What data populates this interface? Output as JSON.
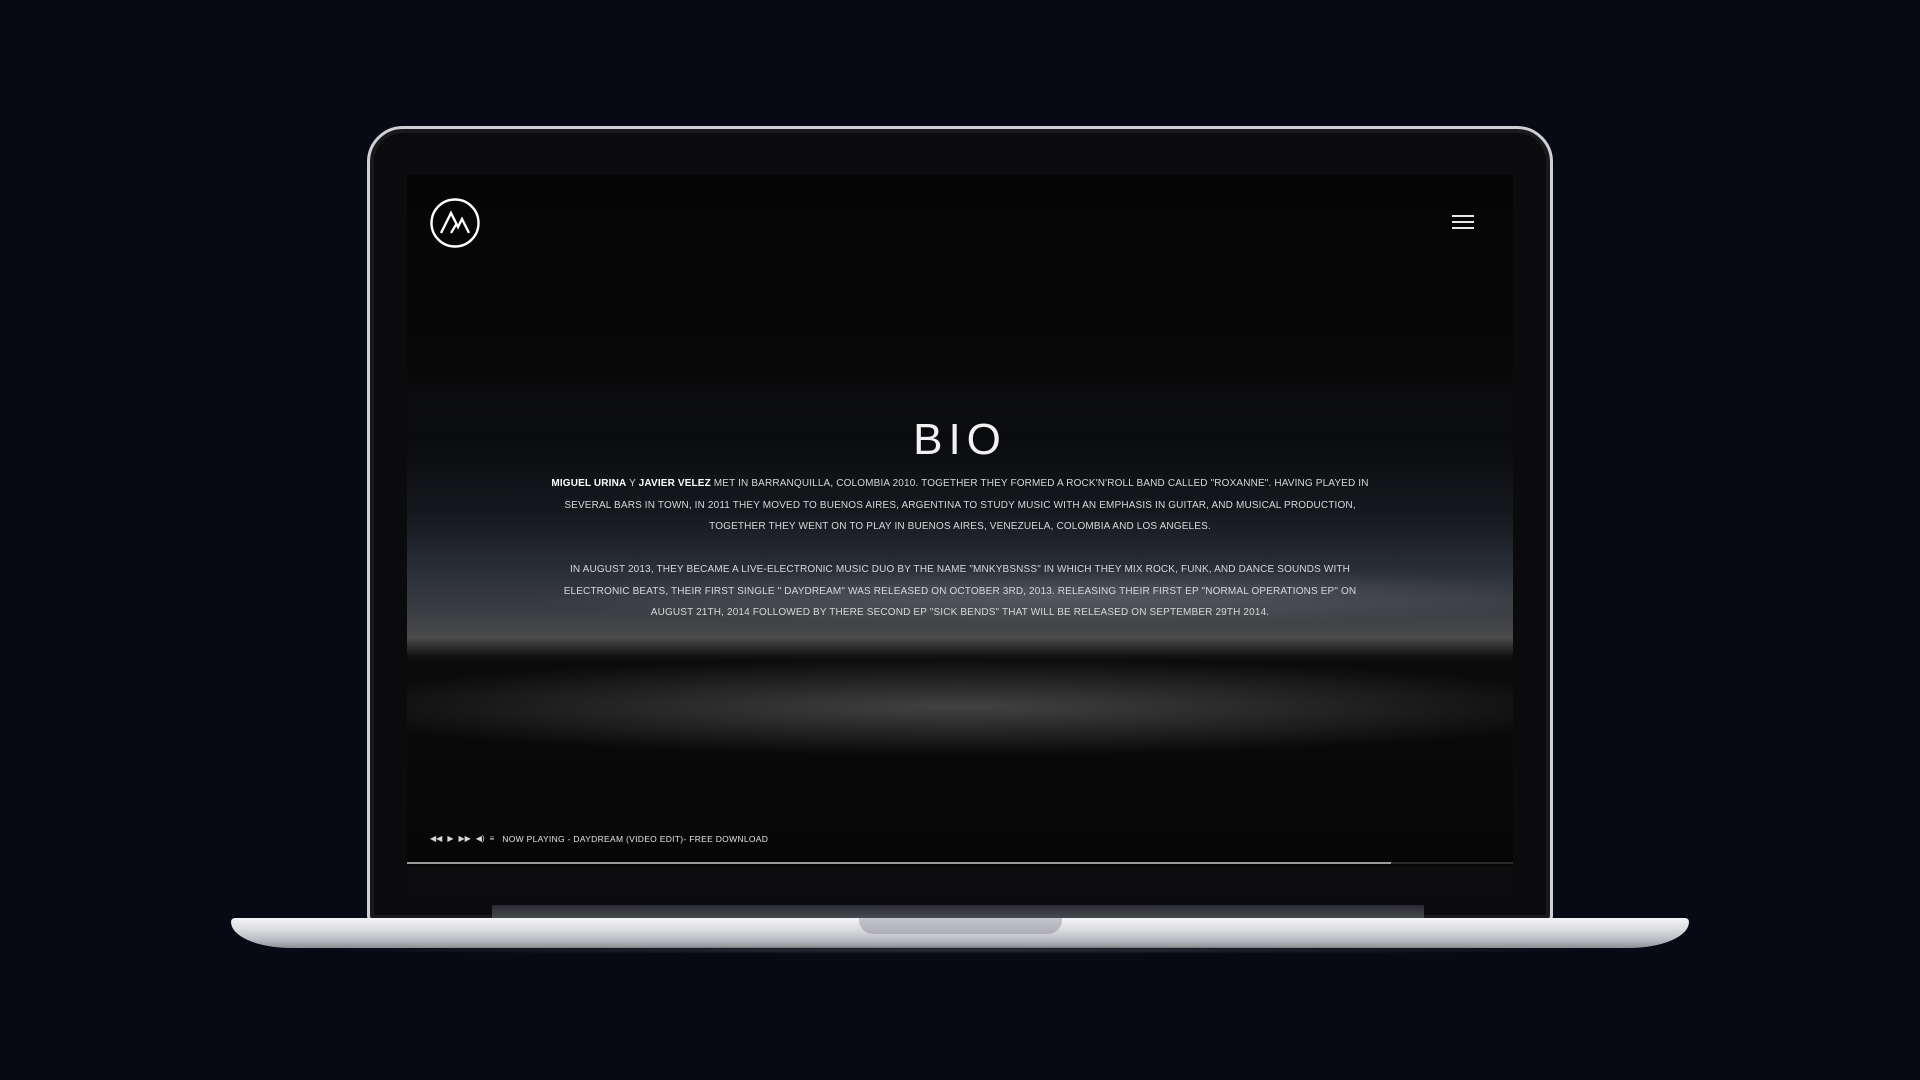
{
  "site": {
    "logo_icon": "mountain-circle-logo-icon",
    "menu_icon": "hamburger-menu-icon"
  },
  "bio": {
    "title": "BIO",
    "paragraph1": {
      "name1": "MIGUEL URINA",
      "conjunction": " Y ",
      "name2": "JAVIER VELEZ",
      "rest": " MET IN BARRANQUILLA, COLOMBIA 2010. TOGETHER THEY FORMED A ROCK'N'ROLL BAND CALLED \"ROXANNE\". HAVING PLAYED IN SEVERAL BARS IN TOWN, IN 2011 THEY MOVED TO BUENOS AIRES, ARGENTINA TO STUDY MUSIC WITH AN EMPHASIS IN GUITAR, AND MUSICAL PRODUCTION, TOGETHER THEY WENT ON TO PLAY IN BUENOS AIRES, VENEZUELA, COLOMBIA AND LOS ANGELES."
    },
    "paragraph2": "IN AUGUST 2013, THEY BECAME A LIVE-ELECTRONIC MUSIC DUO BY THE NAME \"MNKYBSNSS\" IN WHICH THEY MIX ROCK, FUNK, AND DANCE SOUNDS WITH ELECTRONIC BEATS, THEIR FIRST SINGLE \" DAYDREAM\" WAS RELEASED ON OCTOBER 3RD, 2013. RELEASING THEIR FIRST EP \"NORMAL OPERATIONS EP\" ON AUGUST 21TH, 2014 FOLLOWED BY THERE SECOND EP \"SICK BENDS\" THAT WILL BE RELEASED ON SEPTEMBER 29TH 2014."
  },
  "player": {
    "controls": [
      {
        "name": "previous-icon",
        "glyph": "◀◀"
      },
      {
        "name": "play-icon",
        "glyph": "▶"
      },
      {
        "name": "next-icon",
        "glyph": "▶▶"
      },
      {
        "name": "volume-icon",
        "glyph": "◀)"
      },
      {
        "name": "playlist-icon",
        "glyph": "≡"
      }
    ],
    "now_playing": "NOW PLAYING - DAYDREAM (VIDEO EDIT)- FREE DOWNLOAD",
    "progress": 0.89
  },
  "colors": {
    "page_background": "#070914",
    "text": "#d7d7d7",
    "accent": "#ffffff"
  }
}
